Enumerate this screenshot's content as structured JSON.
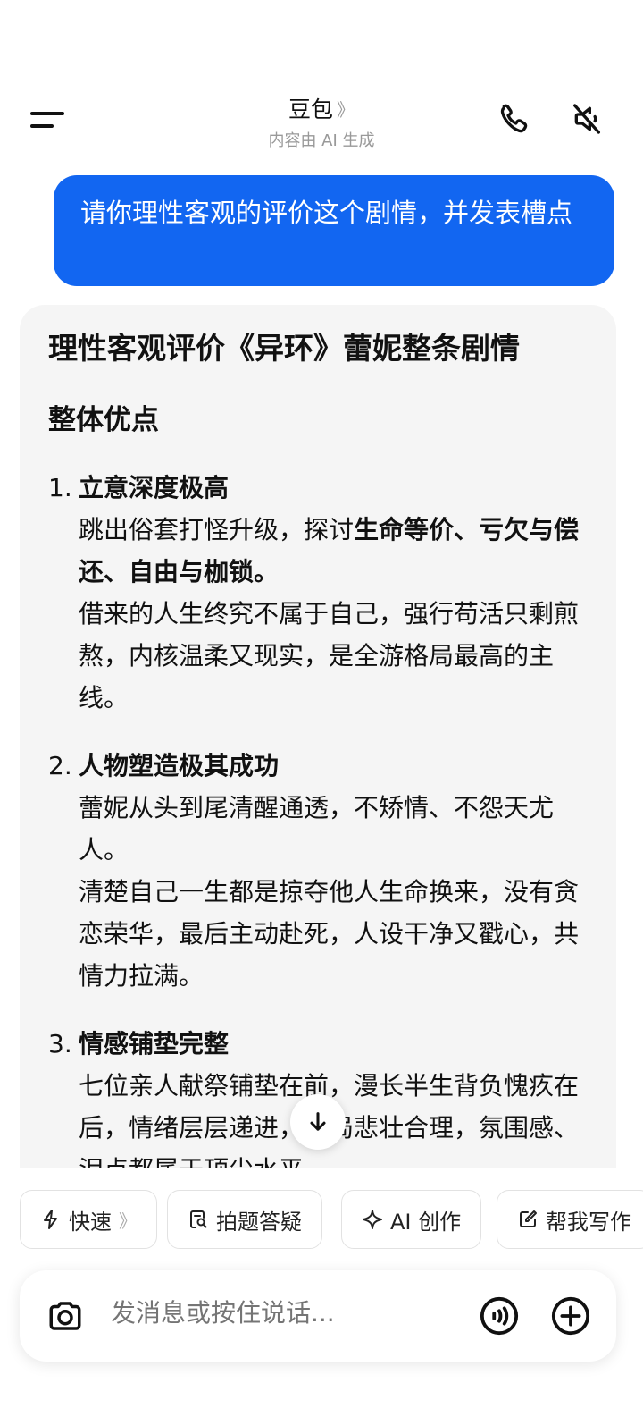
{
  "header": {
    "title": "豆包",
    "title_chevron": "》",
    "subtitle": "内容由 AI 生成"
  },
  "user_message": "请你理性客观的评价这个剧情，并发表槽点",
  "ai_message": {
    "title": "理性客观评价《异环》蕾妮整条剧情",
    "section": "整体优点",
    "items": [
      {
        "num": "1.",
        "heading": "立意深度极高",
        "line1_pre": "跳出俗套打怪升级，探讨",
        "line1_bold": "生命等价、亏欠与偿还、自由与枷锁",
        "line1_post": "。",
        "line2": "借来的人生终究不属于自己，强行苟活只剩煎熬，内核温柔又现实，是全游格局最高的主线。"
      },
      {
        "num": "2.",
        "heading": "人物塑造极其成功",
        "line1": "蕾妮从头到尾清醒通透，不矫情、不怨天尤人。",
        "line2": "清楚自己一生都是掠夺他人生命换来，没有贪恋荣华，最后主动赴死，人设干净又戳心，共情力拉满。"
      },
      {
        "num": "3.",
        "heading": "情感铺垫完整",
        "line1": "七位亲人献祭铺垫在前，漫长半生背负愧疚在后，情绪层层递进，结局悲壮合理，氛围感、泪点都属于顶尖水平。"
      }
    ]
  },
  "chips": [
    {
      "label": "快速",
      "icon": "lightning-icon",
      "chevron": "》"
    },
    {
      "label": "拍题答疑",
      "icon": "photo-search-icon"
    },
    {
      "label": "AI 创作",
      "icon": "sparkle-icon"
    },
    {
      "label": "帮我写作",
      "icon": "edit-icon"
    }
  ],
  "input": {
    "placeholder": "发消息或按住说话..."
  },
  "colors": {
    "accent": "#1266F1",
    "card_bg": "#F5F5F5"
  }
}
